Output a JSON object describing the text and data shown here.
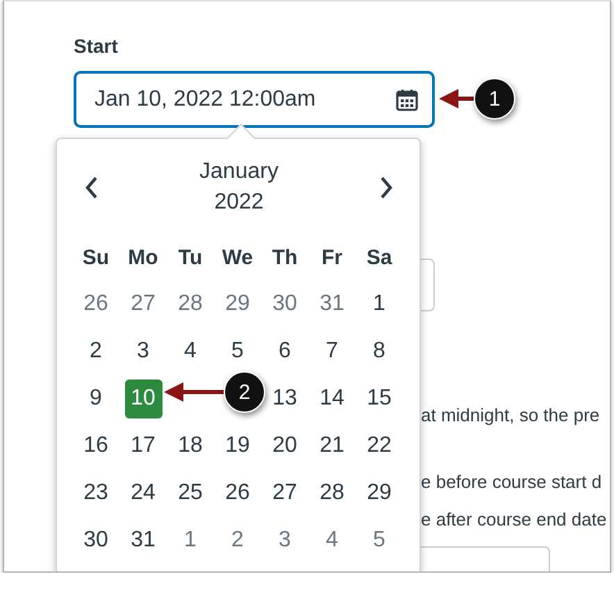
{
  "field": {
    "label": "Start",
    "value": "Jan 10, 2022 12:00am"
  },
  "background_texts": [
    "at midnight, so the pre",
    "e before course start d",
    "e after course end date"
  ],
  "calendar": {
    "month": "January",
    "year": "2022",
    "weekdays": [
      "Su",
      "Mo",
      "Tu",
      "We",
      "Th",
      "Fr",
      "Sa"
    ],
    "weeks": [
      [
        {
          "kind": "day",
          "day": "26",
          "outside": true,
          "selected": false
        },
        {
          "kind": "day",
          "day": "27",
          "outside": true,
          "selected": false
        },
        {
          "kind": "day",
          "day": "28",
          "outside": true,
          "selected": false
        },
        {
          "kind": "day",
          "day": "29",
          "outside": true,
          "selected": false
        },
        {
          "kind": "day",
          "day": "30",
          "outside": true,
          "selected": false
        },
        {
          "kind": "day",
          "day": "31",
          "outside": true,
          "selected": false
        },
        {
          "kind": "day",
          "day": "1",
          "outside": false,
          "selected": false
        }
      ],
      [
        {
          "kind": "day",
          "day": "2",
          "outside": false,
          "selected": false
        },
        {
          "kind": "day",
          "day": "3",
          "outside": false,
          "selected": false
        },
        {
          "kind": "day",
          "day": "4",
          "outside": false,
          "selected": false
        },
        {
          "kind": "day",
          "day": "5",
          "outside": false,
          "selected": false
        },
        {
          "kind": "day",
          "day": "6",
          "outside": false,
          "selected": false
        },
        {
          "kind": "day",
          "day": "7",
          "outside": false,
          "selected": false
        },
        {
          "kind": "day",
          "day": "8",
          "outside": false,
          "selected": false
        }
      ],
      [
        {
          "kind": "day",
          "day": "9",
          "outside": false,
          "selected": false
        },
        {
          "kind": "day",
          "day": "10",
          "outside": false,
          "selected": true
        },
        {
          "kind": "hidden"
        },
        {
          "kind": "hidden"
        },
        {
          "kind": "day",
          "day": "13",
          "outside": false,
          "selected": false
        },
        {
          "kind": "day",
          "day": "14",
          "outside": false,
          "selected": false
        },
        {
          "kind": "day",
          "day": "15",
          "outside": false,
          "selected": false
        }
      ],
      [
        {
          "kind": "day",
          "day": "16",
          "outside": false,
          "selected": false
        },
        {
          "kind": "day",
          "day": "17",
          "outside": false,
          "selected": false
        },
        {
          "kind": "day",
          "day": "18",
          "outside": false,
          "selected": false
        },
        {
          "kind": "day",
          "day": "19",
          "outside": false,
          "selected": false
        },
        {
          "kind": "day",
          "day": "20",
          "outside": false,
          "selected": false
        },
        {
          "kind": "day",
          "day": "21",
          "outside": false,
          "selected": false
        },
        {
          "kind": "day",
          "day": "22",
          "outside": false,
          "selected": false
        }
      ],
      [
        {
          "kind": "day",
          "day": "23",
          "outside": false,
          "selected": false
        },
        {
          "kind": "day",
          "day": "24",
          "outside": false,
          "selected": false
        },
        {
          "kind": "day",
          "day": "25",
          "outside": false,
          "selected": false
        },
        {
          "kind": "day",
          "day": "26",
          "outside": false,
          "selected": false
        },
        {
          "kind": "day",
          "day": "27",
          "outside": false,
          "selected": false
        },
        {
          "kind": "day",
          "day": "28",
          "outside": false,
          "selected": false
        },
        {
          "kind": "day",
          "day": "29",
          "outside": false,
          "selected": false
        }
      ],
      [
        {
          "kind": "day",
          "day": "30",
          "outside": false,
          "selected": false
        },
        {
          "kind": "day",
          "day": "31",
          "outside": false,
          "selected": false
        },
        {
          "kind": "day",
          "day": "1",
          "outside": true,
          "selected": false
        },
        {
          "kind": "day",
          "day": "2",
          "outside": true,
          "selected": false
        },
        {
          "kind": "day",
          "day": "3",
          "outside": true,
          "selected": false
        },
        {
          "kind": "day",
          "day": "4",
          "outside": true,
          "selected": false
        },
        {
          "kind": "day",
          "day": "5",
          "outside": true,
          "selected": false
        }
      ]
    ]
  },
  "callouts": [
    {
      "number": "1"
    },
    {
      "number": "2"
    }
  ]
}
